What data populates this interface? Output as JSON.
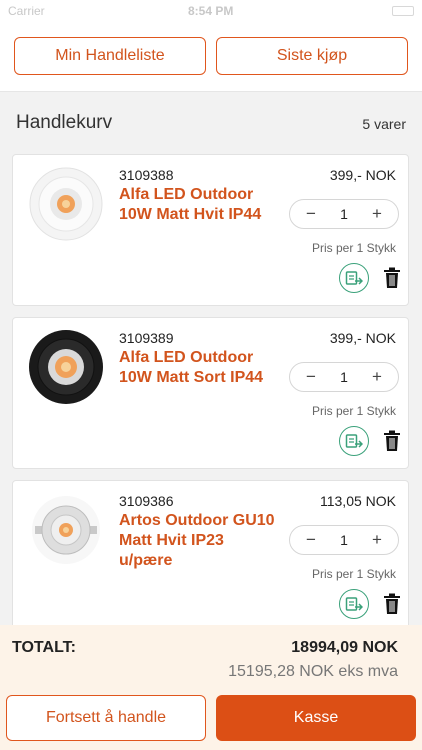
{
  "status_bar": {
    "carrier": "Carrier",
    "time": "8:54 PM"
  },
  "top_buttons": {
    "shopping_list": "Min Handleliste",
    "last_purchase": "Siste kjøp"
  },
  "cart": {
    "title": "Handlekurv",
    "count": "5 varer"
  },
  "items": [
    {
      "sku": "3109388",
      "name": "Alfa LED Outdoor 10W Matt Hvit IP44",
      "price": "399,- NOK",
      "qty": "1",
      "unit": "Pris per 1 Stykk",
      "image": "white-downlight"
    },
    {
      "sku": "3109389",
      "name": "Alfa LED Outdoor 10W Matt Sort IP44",
      "price": "399,- NOK",
      "qty": "1",
      "unit": "Pris per 1 Stykk",
      "image": "black-downlight"
    },
    {
      "sku": "3109386",
      "name": "Artos Outdoor GU10 Matt Hvit IP23 u/pære",
      "price": "113,05 NOK",
      "qty": "1",
      "unit": "Pris per 1 Stykk",
      "image": "silver-downlight"
    }
  ],
  "stepper": {
    "minus": "−",
    "plus": "+"
  },
  "icons": {
    "move": "move-to-list-icon",
    "delete": "trash-icon"
  },
  "totals": {
    "label": "TOTALT:",
    "total": "18994,09 NOK",
    "ex_vat": "15195,28 NOK eks mva"
  },
  "actions": {
    "continue": "Fortsett å handle",
    "checkout": "Kasse"
  },
  "colors": {
    "accent": "#dc4f15",
    "green": "#3aa17a",
    "footer_bg": "#fdf3e8"
  }
}
